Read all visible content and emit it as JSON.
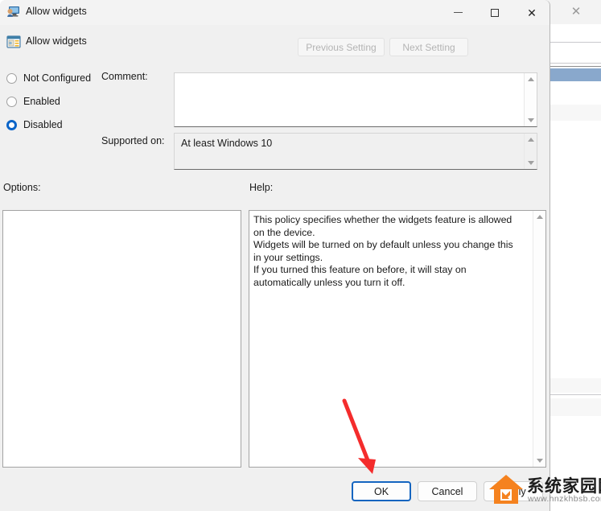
{
  "window": {
    "title": "Allow widgets",
    "title_icon": "computer-policy-icon",
    "minimize_label": "—",
    "maximize_label": "□",
    "close_label": "×"
  },
  "header": {
    "policy_name": "Allow widgets",
    "policy_icon": "policy-setting-icon",
    "previous_setting_label": "Previous Setting",
    "next_setting_label": "Next Setting",
    "previous_setting_enabled": "false",
    "next_setting_enabled": "false"
  },
  "state": {
    "options": [
      {
        "label": "Not Configured",
        "selected": "false"
      },
      {
        "label": "Enabled",
        "selected": "false"
      },
      {
        "label": "Disabled",
        "selected": "true"
      }
    ],
    "selected_value": "Disabled"
  },
  "comment": {
    "label": "Comment:",
    "value": "",
    "placeholder": ""
  },
  "supported": {
    "label": "Supported on:",
    "value": "At least Windows 10"
  },
  "panels": {
    "options_label": "Options:",
    "options_content": "",
    "help_label": "Help:",
    "help_text": "This policy specifies whether the widgets feature is allowed on the device.\nWidgets will be turned on by default unless you change this in your settings.\nIf you turned this feature on before, it will stay on automatically unless you turn it off."
  },
  "footer": {
    "ok_label": "OK",
    "cancel_label": "Cancel",
    "apply_label": "Apply",
    "default_button": "OK"
  },
  "annotation": {
    "arrow_color": "#f42c2c",
    "points_to": "OK"
  },
  "watermark": {
    "site_name": "系统家园网",
    "url": "www.hnzkhbsb.com",
    "logo_color": "#f5821f"
  },
  "colors": {
    "accent": "#0a64c8",
    "focus_border": "#1565c0",
    "dialog_bg": "#f0f0f0",
    "titlebar_bg": "#f3f3f3",
    "selection_blue": "#89a8cc"
  }
}
